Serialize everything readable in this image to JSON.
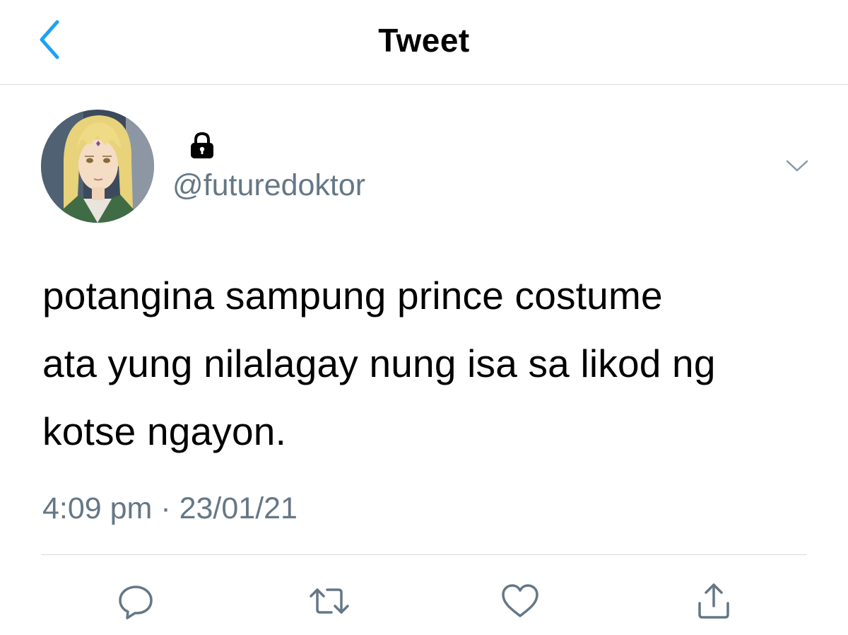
{
  "nav": {
    "title": "Tweet",
    "back_icon": "chevron-left-icon"
  },
  "tweet": {
    "avatar_icon": "user-avatar",
    "protected_icon": "lock-icon",
    "handle": "@futuredoktor",
    "text_lines": [
      "potangina sampung prince costume",
      "ata yung nilalagay nung isa sa likod ng",
      "kotse ngayon."
    ],
    "timestamp": "4:09 pm · 23/01/21"
  },
  "actions": [
    {
      "name": "reply",
      "icon": "comment-icon"
    },
    {
      "name": "retweet",
      "icon": "retweet-icon"
    },
    {
      "name": "like",
      "icon": "heart-icon"
    },
    {
      "name": "share",
      "icon": "share-icon"
    }
  ],
  "colors": {
    "accent": "#1da1f2",
    "secondary_text": "#657786",
    "divider": "#d6dbe1",
    "text": "#000000"
  }
}
